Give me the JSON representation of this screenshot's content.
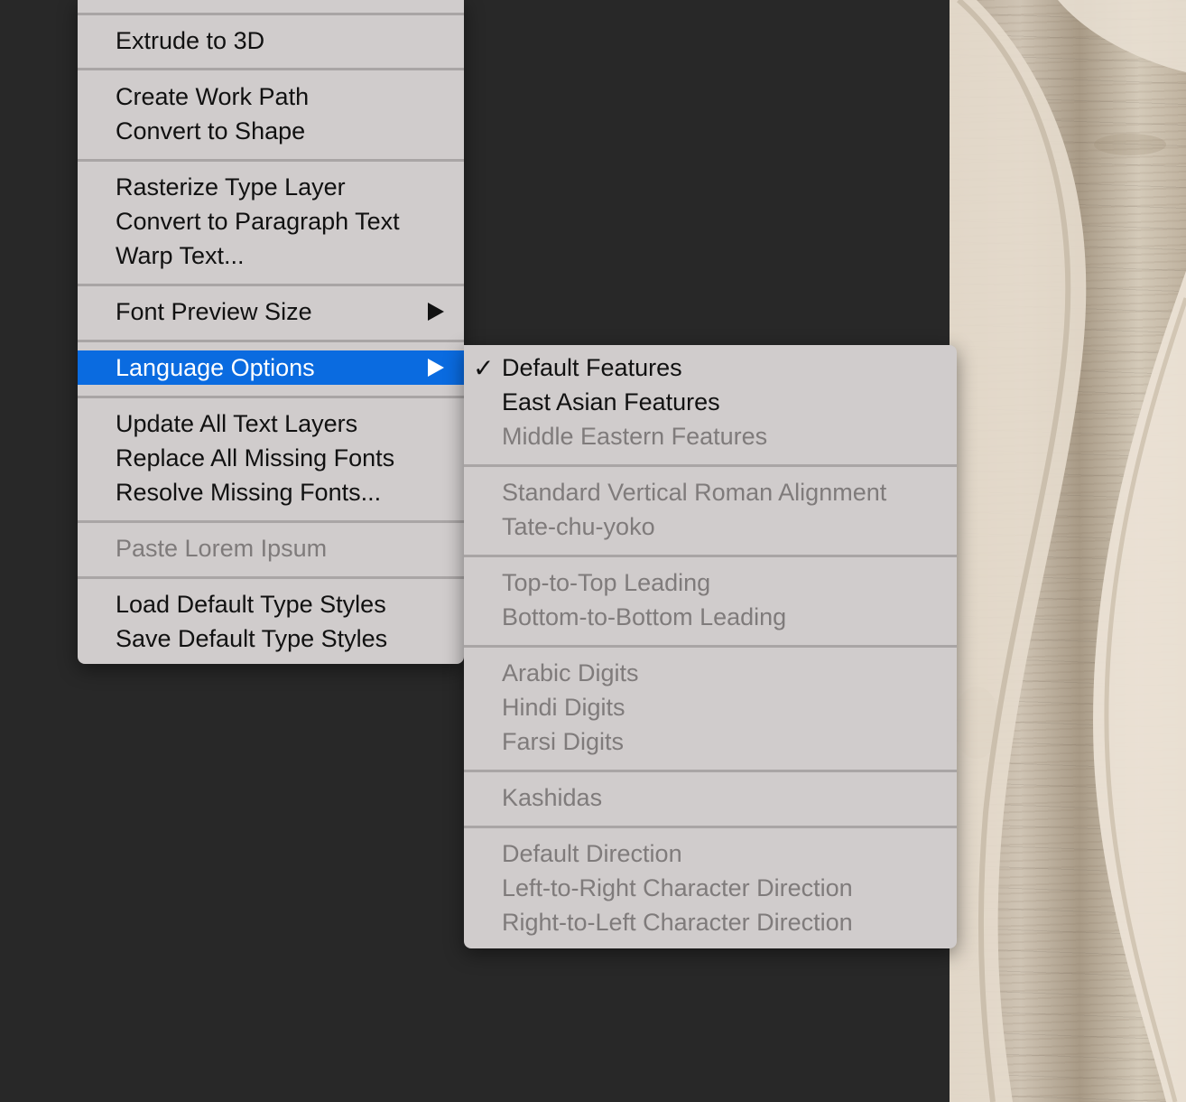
{
  "main_menu": {
    "items": [
      {
        "label": "Extrude to 3D",
        "enabled": true
      },
      {
        "label": "Create Work Path",
        "enabled": true
      },
      {
        "label": "Convert to Shape",
        "enabled": true
      },
      {
        "label": "Rasterize Type Layer",
        "enabled": true
      },
      {
        "label": "Convert to Paragraph Text",
        "enabled": true
      },
      {
        "label": "Warp Text...",
        "enabled": true
      },
      {
        "label": "Font Preview Size",
        "enabled": true,
        "submenu": true
      },
      {
        "label": "Language Options",
        "enabled": true,
        "submenu": true,
        "highlighted": true
      },
      {
        "label": "Update All Text Layers",
        "enabled": true
      },
      {
        "label": "Replace All Missing Fonts",
        "enabled": true
      },
      {
        "label": "Resolve Missing Fonts...",
        "enabled": true
      },
      {
        "label": "Paste Lorem Ipsum",
        "enabled": false
      },
      {
        "label": "Load Default Type Styles",
        "enabled": true
      },
      {
        "label": "Save Default Type Styles",
        "enabled": true
      }
    ],
    "arrow_icon": "triangle-right-icon"
  },
  "submenu": {
    "check_glyph": "✓",
    "items": [
      {
        "label": "Default Features",
        "enabled": true,
        "checked": true
      },
      {
        "label": "East Asian Features",
        "enabled": true
      },
      {
        "label": "Middle Eastern Features",
        "enabled": false
      },
      {
        "label": "Standard Vertical Roman Alignment",
        "enabled": false
      },
      {
        "label": "Tate-chu-yoko",
        "enabled": false
      },
      {
        "label": "Top-to-Top Leading",
        "enabled": false
      },
      {
        "label": "Bottom-to-Bottom Leading",
        "enabled": false
      },
      {
        "label": "Arabic Digits",
        "enabled": false
      },
      {
        "label": "Hindi Digits",
        "enabled": false
      },
      {
        "label": "Farsi Digits",
        "enabled": false
      },
      {
        "label": "Kashidas",
        "enabled": false
      },
      {
        "label": "Default Direction",
        "enabled": false
      },
      {
        "label": "Left-to-Right Character Direction",
        "enabled": false
      },
      {
        "label": "Right-to-Left Character Direction",
        "enabled": false
      }
    ]
  },
  "colors": {
    "background": "#282828",
    "menu_bg": "#d0cccc",
    "highlight": "#0a6be0",
    "disabled_text": "#7f7b7b"
  }
}
